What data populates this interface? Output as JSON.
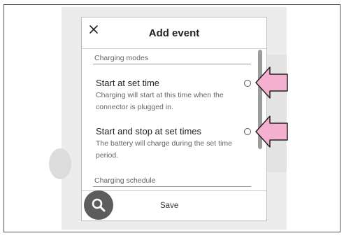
{
  "dialog": {
    "title": "Add event",
    "section_modes": "Charging modes",
    "options": [
      {
        "title": "Start at set time",
        "description": "Charging will start at this time when the connector is plugged in."
      },
      {
        "title": "Start and stop at set times",
        "description": "The battery will charge during the set time period."
      }
    ],
    "section_schedule": "Charging schedule",
    "save_label": "Save"
  },
  "colors": {
    "arrow_fill": "#f4b0cf",
    "fab_bg": "#5d5d5d"
  },
  "icons": [
    "close-icon",
    "search-icon",
    "pointer-arrow-icon"
  ]
}
